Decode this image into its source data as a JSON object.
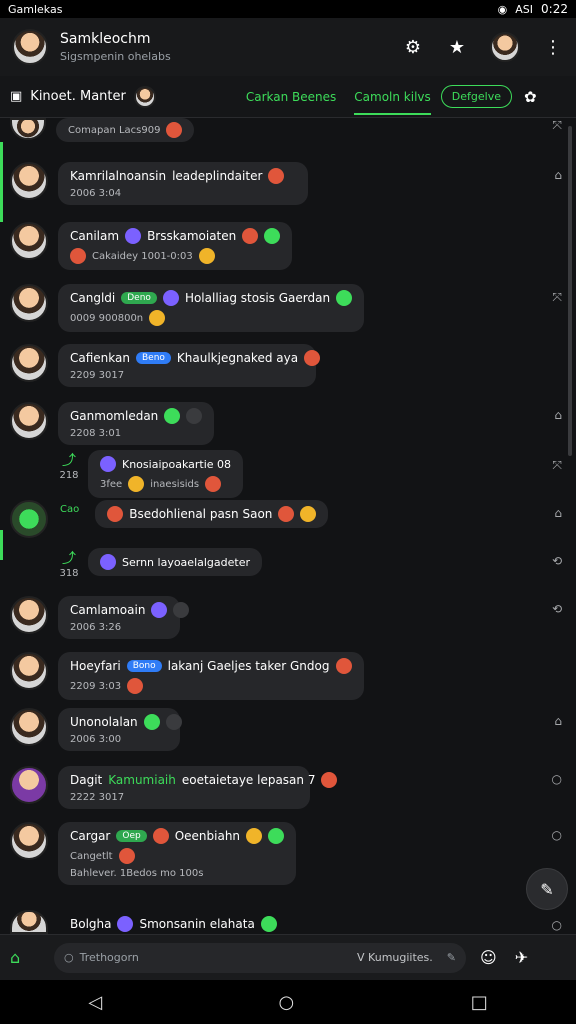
{
  "statusbar": {
    "app": "Gamlekas",
    "battery": "ASI",
    "time": "0:22"
  },
  "header": {
    "title": "Samkleochm",
    "subtitle": "Sigsmpenin ohelabs",
    "settings_icon": "gear-icon",
    "star_icon": "star-icon",
    "menu_icon": "more-vert-icon"
  },
  "tabs": {
    "channel": "Kinoet. Manter",
    "tab1": "Carkan Beenes",
    "tab2": "Camoln kilvs",
    "pill": "Defgelve"
  },
  "messages": [
    {
      "name": "",
      "text": "Comapan Lacs909",
      "time": ""
    },
    {
      "name": "Kamrilalnoansin",
      "text": "leadeplindaiter",
      "time": "2006 3:04"
    },
    {
      "name": "Canilam",
      "text": "Brsskamoiaten",
      "time": "Cakaidey 1001-0:03"
    },
    {
      "name": "Cangldi",
      "badge": "Deno",
      "text": "Holalliag stosis Gaerdan",
      "time": "0009 900800n"
    },
    {
      "name": "Cafienkan",
      "badge": "Beno",
      "text": "Khaulkjegnaked aya",
      "time": "2209 3017"
    },
    {
      "name": "Ganmomledan",
      "text": "",
      "time": "2208 3:01"
    },
    {
      "name": "Cao",
      "text": "Bsedohlienal pasn Saon",
      "time": ""
    },
    {
      "name": "Camlamoain",
      "text": "",
      "time": "2006 3:26"
    },
    {
      "name": "Hoeyfari",
      "badge": "Bono",
      "text": "lakanj Gaeljes taker Gndog",
      "time": "2209 3:03"
    },
    {
      "name": "Unonolalan",
      "text": "",
      "time": "2006 3:00"
    },
    {
      "name": "Dagit",
      "highlight": "Kamumiaih",
      "text": "eoetaietaye lepasan 7",
      "time": "2222 3017"
    },
    {
      "name": "Cargar",
      "badge": "Oep",
      "text": "Oeenbiahn",
      "time": "Cangetlt",
      "extra": "Bahlever. 1Bedos mo 100s"
    },
    {
      "name": "Bolgha",
      "text": "Smonsanin elahata",
      "time": ""
    }
  ],
  "replies": [
    {
      "count": "218",
      "text": "Knosiaipoakartie 08",
      "sub": "3fee",
      "sub2": "inaesisids"
    },
    {
      "count": "318",
      "text": "Sernn layoaelalgadeter"
    },
    {
      "count": "316",
      "text": ""
    }
  ],
  "composer": {
    "placeholder": "Trethogorn",
    "keyword": "V Kumugiites."
  },
  "nav": {
    "back": "◁",
    "home": "○",
    "recents": "□"
  }
}
